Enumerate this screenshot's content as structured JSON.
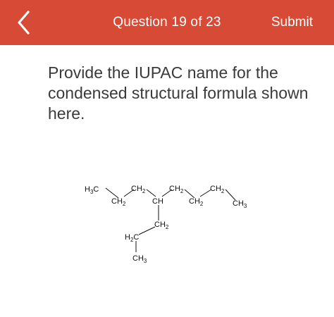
{
  "header": {
    "back_icon": "chevron-left-icon",
    "title": "Question 19 of 23",
    "submit_label": "Submit",
    "background_color": "#d64a36",
    "text_color": "#ffffff"
  },
  "question": {
    "prompt": "Provide the IUPAC name for the condensed structural formula shown here."
  },
  "structure": {
    "groups": [
      {
        "main": "H",
        "sub": "3",
        "tail": "C"
      },
      {
        "main": "CH",
        "sub": "2",
        "tail": ""
      },
      {
        "main": "CH",
        "sub": "2",
        "tail": ""
      },
      {
        "main": "CH",
        "sub": "",
        "tail": ""
      },
      {
        "main": "CH",
        "sub": "2",
        "tail": ""
      },
      {
        "main": "CH",
        "sub": "2",
        "tail": ""
      },
      {
        "main": "CH",
        "sub": "2",
        "tail": ""
      },
      {
        "main": "CH",
        "sub": "3",
        "tail": ""
      },
      {
        "main": "CH",
        "sub": "2",
        "tail": ""
      },
      {
        "main": "H",
        "sub": "2",
        "tail": "C"
      },
      {
        "main": "CH",
        "sub": "3",
        "tail": ""
      }
    ]
  }
}
